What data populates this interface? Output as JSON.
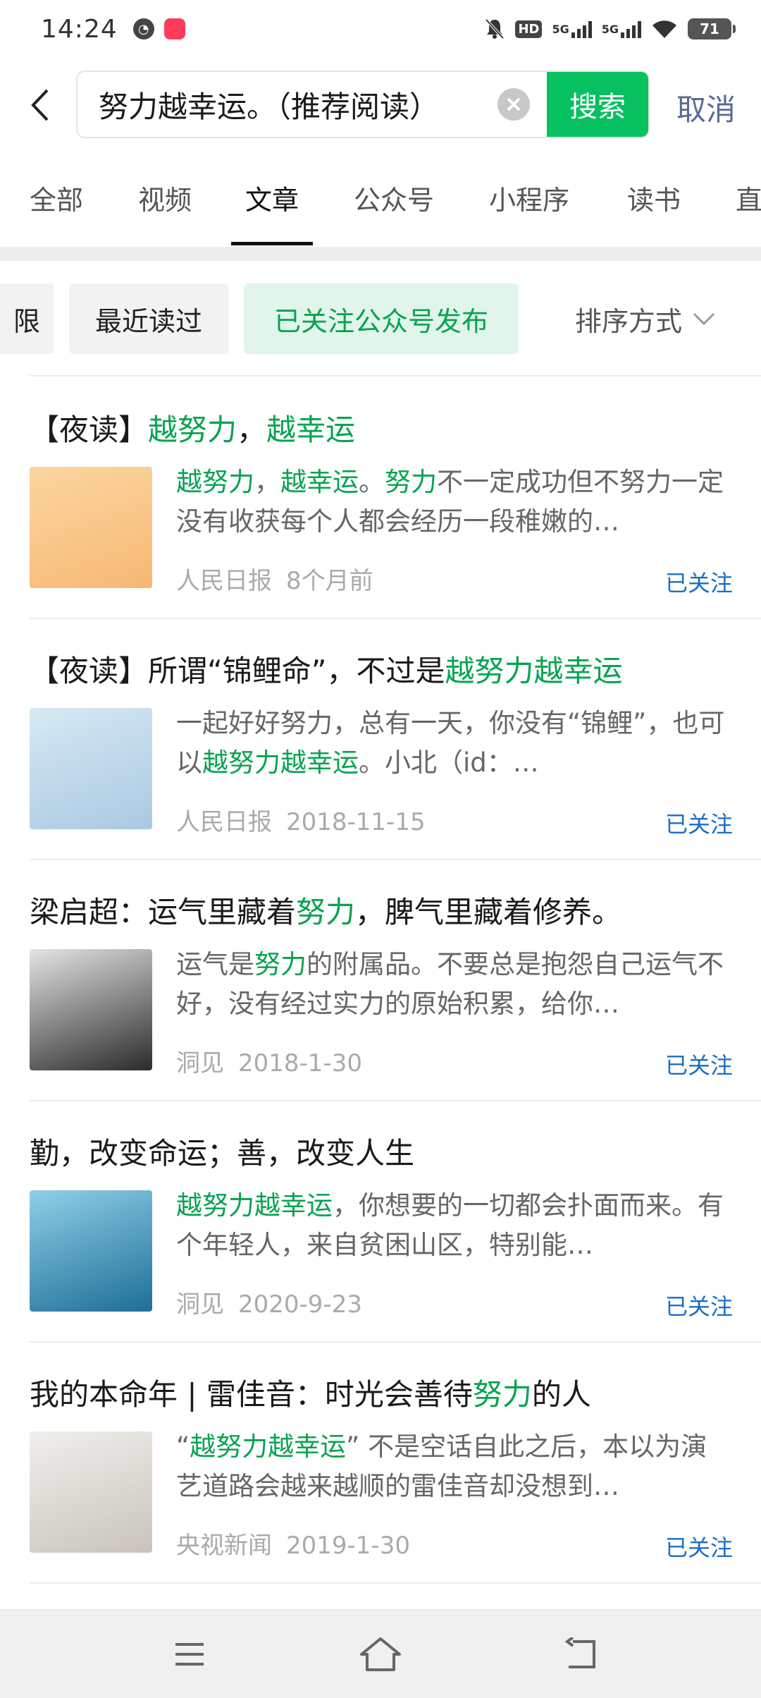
{
  "status_bar": {
    "time": "14:24",
    "hd_label": "HD",
    "net1": "5G",
    "net2": "5G",
    "battery": "71"
  },
  "search": {
    "query": "努力越幸运。（推荐阅读）",
    "search_label": "搜索",
    "cancel_label": "取消"
  },
  "tabs": [
    "全部",
    "视频",
    "文章",
    "公众号",
    "小程序",
    "读书",
    "直"
  ],
  "active_tab": "文章",
  "filters": {
    "chip0": "限",
    "chip1": "最近读过",
    "chip2": "已关注公众号发布",
    "sort_label": "排序方式"
  },
  "articles": [
    {
      "title": [
        {
          "t": "【夜读】"
        },
        {
          "t": "越努力",
          "hl": true
        },
        {
          "t": "，"
        },
        {
          "t": "越幸运",
          "hl": true
        }
      ],
      "summary": [
        {
          "t": "越努力",
          "hl": true
        },
        {
          "t": "，"
        },
        {
          "t": "越幸运",
          "hl": true
        },
        {
          "t": "。"
        },
        {
          "t": "努力",
          "hl": true
        },
        {
          "t": "不一定成功但不努力一定没有收获每个人都会经历一段稚嫩的…"
        }
      ],
      "source": "人民日报",
      "date": "8个月前",
      "follow": "已关注",
      "thumb_colors": [
        "#fcd6a0",
        "#f6b874"
      ]
    },
    {
      "title": [
        {
          "t": "【夜读】所谓“锦鲤命”，不过是"
        },
        {
          "t": "越努力越幸运",
          "hl": true
        }
      ],
      "summary": [
        {
          "t": "一起好好努力，总有一天，你没有“锦鲤”，也可以"
        },
        {
          "t": "越努力越幸运",
          "hl": true
        },
        {
          "t": "。小北（id：…"
        }
      ],
      "source": "人民日报",
      "date": "2018-11-15",
      "follow": "已关注",
      "thumb_colors": [
        "#d7e9f4",
        "#a9c9e2"
      ]
    },
    {
      "title": [
        {
          "t": "梁启超：运气里藏着"
        },
        {
          "t": "努力",
          "hl": true
        },
        {
          "t": "，脾气里藏着修养。"
        }
      ],
      "summary": [
        {
          "t": "运气是"
        },
        {
          "t": "努力",
          "hl": true
        },
        {
          "t": "的附属品。不要总是抱怨自己运气不好，没有经过实力的原始积累，给你…"
        }
      ],
      "source": "洞见",
      "date": "2018-1-30",
      "follow": "已关注",
      "thumb_colors": [
        "#e4e4e4",
        "#2b2b2b"
      ]
    },
    {
      "title": [
        {
          "t": "勤，改变命运；善，改变人生"
        }
      ],
      "summary": [
        {
          "t": "越努力越幸运",
          "hl": true
        },
        {
          "t": "，你想要的一切都会扑面而来。有个年轻人，来自贫困山区，特别能…"
        }
      ],
      "source": "洞见",
      "date": "2020-9-23",
      "follow": "已关注",
      "thumb_colors": [
        "#8ed0e8",
        "#1f6e97"
      ]
    },
    {
      "title": [
        {
          "t": "我的本命年 | 雷佳音：时光会善待"
        },
        {
          "t": "努力",
          "hl": true
        },
        {
          "t": "的人"
        }
      ],
      "summary": [
        {
          "t": "“"
        },
        {
          "t": "越努力越幸运",
          "hl": true
        },
        {
          "t": "” 不是空话自此之后，本以为演艺道路会越来越顺的雷佳音却没想到…"
        }
      ],
      "source": "央视新闻",
      "date": "2019-1-30",
      "follow": "已关注",
      "thumb_colors": [
        "#f1efec",
        "#c9c3bd"
      ]
    }
  ]
}
